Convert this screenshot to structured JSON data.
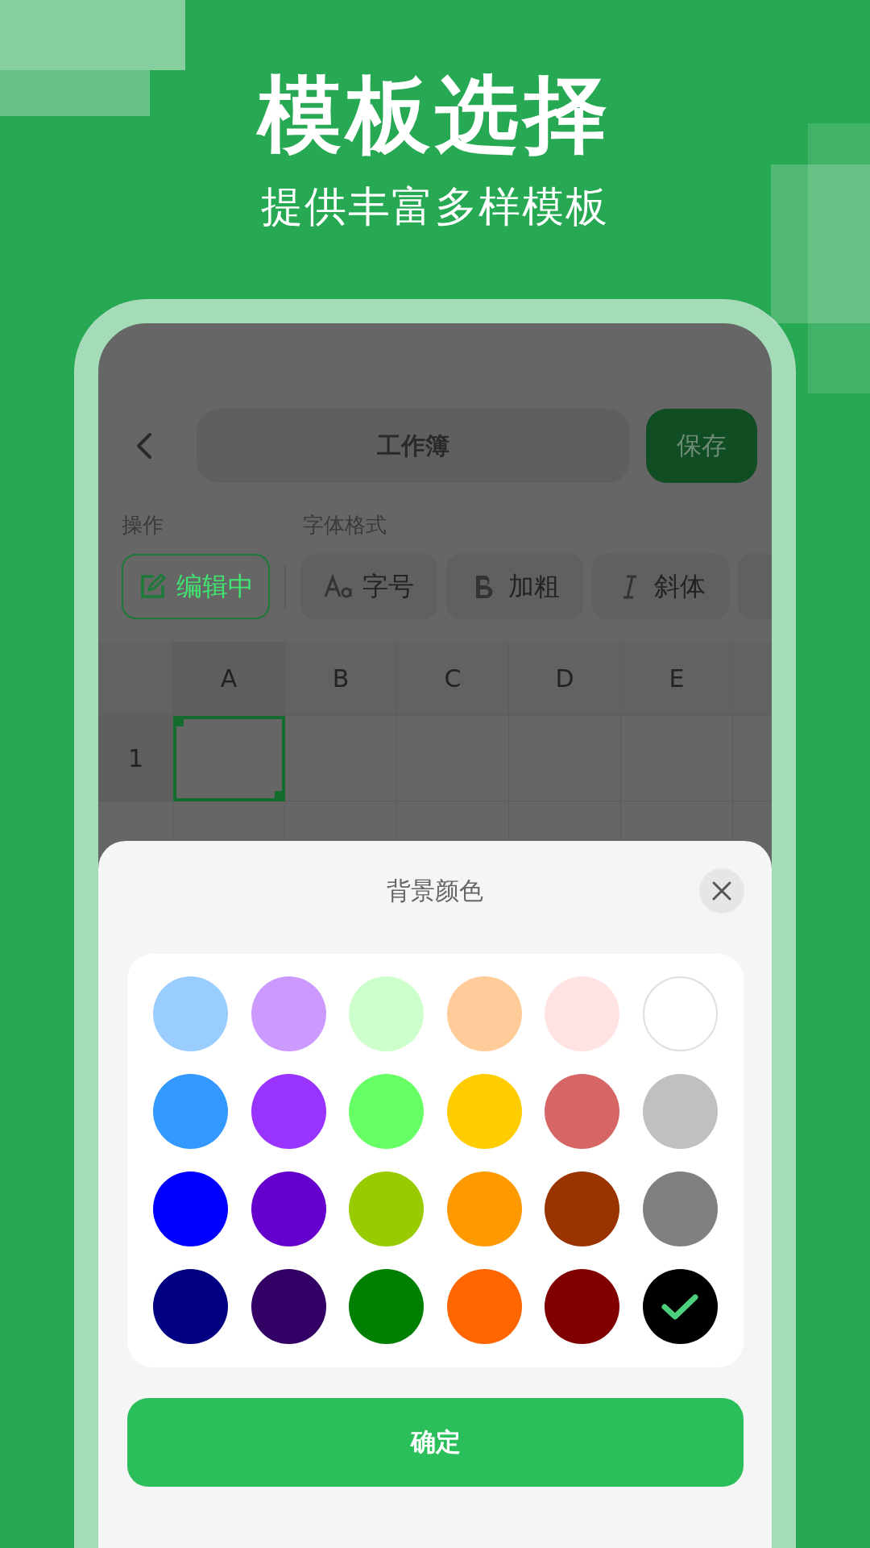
{
  "header": {
    "title": "模板选择",
    "subtitle": "提供丰富多样模板"
  },
  "top_bar": {
    "title": "工作簿",
    "save_button": "保存"
  },
  "toolbar": {
    "sections": [
      {
        "label": "操作"
      },
      {
        "label": "字体格式"
      }
    ],
    "buttons": [
      {
        "kind": "edit",
        "label": "编辑中",
        "active": true
      },
      {
        "kind": "font-size",
        "label": "字号",
        "active": false
      },
      {
        "kind": "bold",
        "label": "加粗",
        "active": false
      },
      {
        "kind": "italic",
        "label": "斜体",
        "active": false
      },
      {
        "kind": "other",
        "active": false
      }
    ]
  },
  "sheet_grid": {
    "columns": [
      "A",
      "B",
      "C",
      "D",
      "E",
      ""
    ],
    "rows": [
      {
        "label": "1",
        "cells": [
          {
            "selected": true
          },
          {
            "selected": false
          },
          {
            "selected": false
          },
          {
            "selected": false
          },
          {
            "selected": false
          },
          {
            "selected": false
          }
        ]
      }
    ]
  },
  "color_sheet": {
    "title": "背景颜色",
    "colors": [
      {
        "color": "#99ccff",
        "selected": false
      },
      {
        "color": "#cc99ff",
        "selected": false
      },
      {
        "color": "#ccffcc",
        "selected": false
      },
      {
        "color": "#ffcc99",
        "selected": false
      },
      {
        "color": "#ffe3e3",
        "selected": false
      },
      {
        "color": "#ffffff",
        "selected": false,
        "outlined": true
      },
      {
        "color": "#3399ff",
        "selected": false
      },
      {
        "color": "#9933ff",
        "selected": false
      },
      {
        "color": "#66ff66",
        "selected": false
      },
      {
        "color": "#ffcc00",
        "selected": false
      },
      {
        "color": "#d66666",
        "selected": false
      },
      {
        "color": "#c0c0c0",
        "selected": false
      },
      {
        "color": "#0000ff",
        "selected": false
      },
      {
        "color": "#6600cc",
        "selected": false
      },
      {
        "color": "#99cc00",
        "selected": false
      },
      {
        "color": "#ff9900",
        "selected": false
      },
      {
        "color": "#993300",
        "selected": false
      },
      {
        "color": "#808080",
        "selected": false
      },
      {
        "color": "#000080",
        "selected": false
      },
      {
        "color": "#330066",
        "selected": false
      },
      {
        "color": "#008000",
        "selected": false
      },
      {
        "color": "#ff6600",
        "selected": false
      },
      {
        "color": "#800000",
        "selected": false
      },
      {
        "color": "#000000",
        "selected": true
      }
    ],
    "confirm_button": "确定"
  }
}
